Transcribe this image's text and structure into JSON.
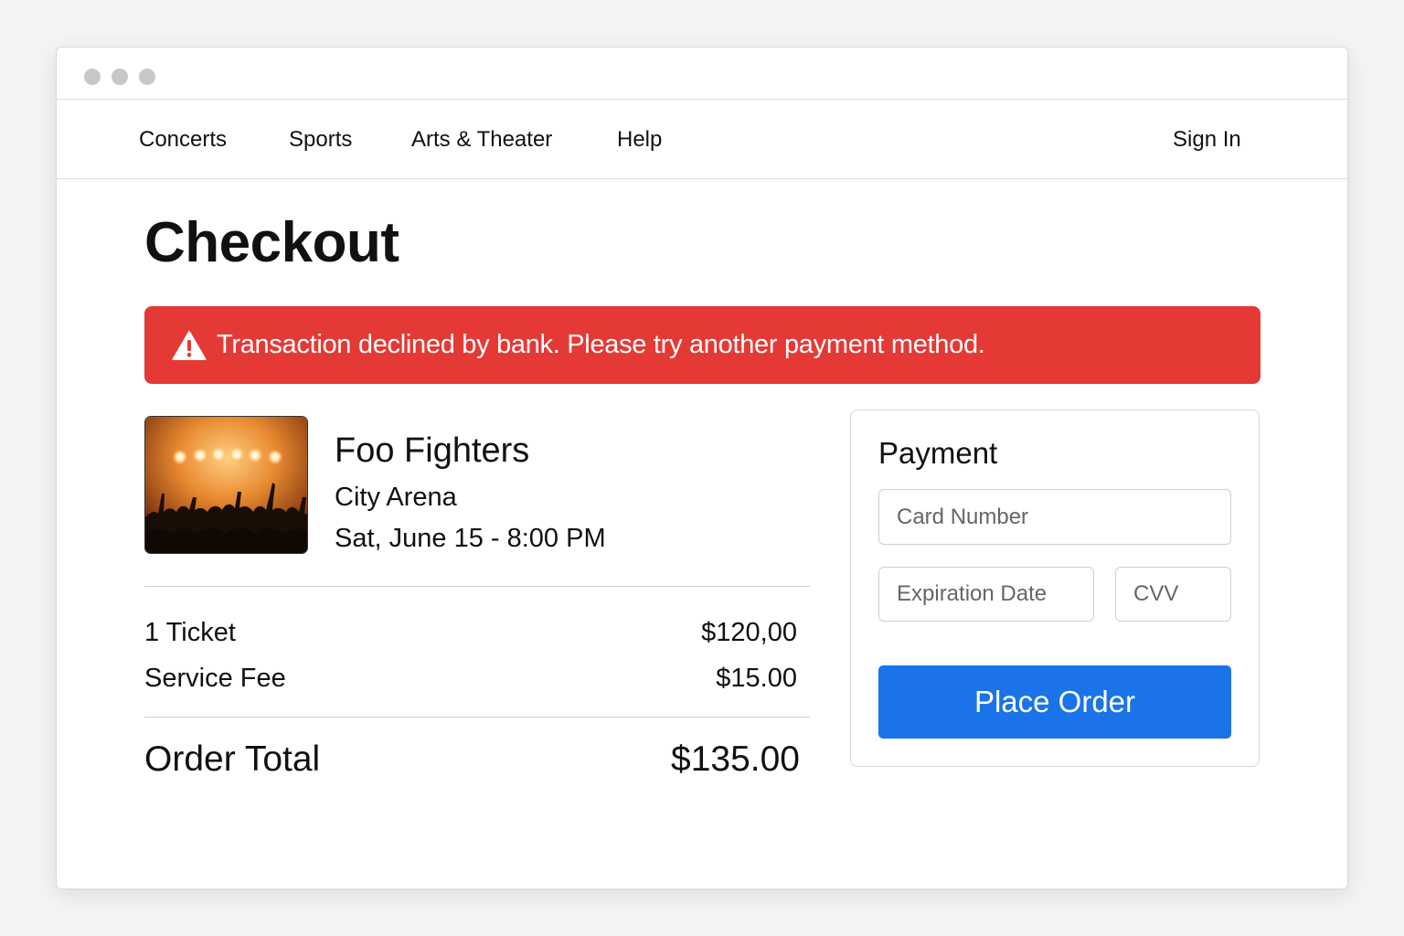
{
  "nav": {
    "links": [
      "Concerts",
      "Sports",
      "Arts & Theater",
      "Help"
    ],
    "sign_in": "Sign In"
  },
  "page": {
    "title": "Checkout"
  },
  "alert": {
    "message": "Transaction declined by bank. Please try another payment method.",
    "color": "#e53935",
    "icon": "warning-triangle-icon"
  },
  "event": {
    "name": "Foo Fighters",
    "venue": "City Arena",
    "date": "Sat, June 15 - 8:00 PM",
    "image": "concert-crowd-image"
  },
  "order": {
    "lines": [
      {
        "label": "1 Ticket",
        "value": "$120,00"
      },
      {
        "label": "Service Fee",
        "value": "$15.00"
      }
    ],
    "total_label": "Order Total",
    "total_value": "$135.00"
  },
  "payment": {
    "title": "Payment",
    "card_placeholder": "Card Number",
    "expiry_placeholder": "Expiration Date",
    "cvv_placeholder": "CVV",
    "submit_label": "Place Order",
    "button_color": "#1a73e8"
  }
}
